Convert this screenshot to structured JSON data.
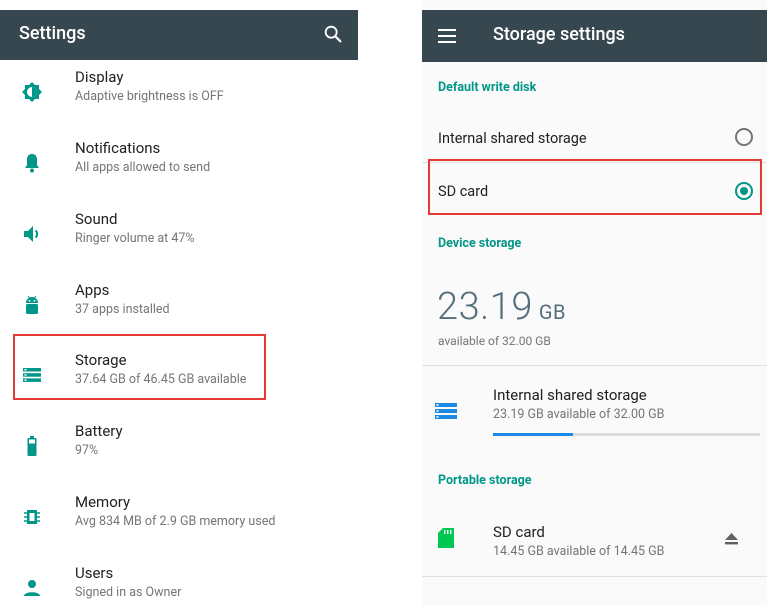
{
  "left": {
    "title": "Settings",
    "items": [
      {
        "title": "Display",
        "subtitle": "Adaptive brightness is OFF",
        "icon": "brightness-icon"
      },
      {
        "title": "Notifications",
        "subtitle": "All apps allowed to send",
        "icon": "bell-icon"
      },
      {
        "title": "Sound",
        "subtitle": "Ringer volume at 47%",
        "icon": "volume-icon"
      },
      {
        "title": "Apps",
        "subtitle": "37 apps installed",
        "icon": "android-icon"
      },
      {
        "title": "Storage",
        "subtitle": "37.64 GB of 46.45 GB available",
        "icon": "storage-icon"
      },
      {
        "title": "Battery",
        "subtitle": "97%",
        "icon": "battery-icon"
      },
      {
        "title": "Memory",
        "subtitle": "Avg 834 MB of 2.9 GB memory used",
        "icon": "memory-icon"
      },
      {
        "title": "Users",
        "subtitle": "Signed in as Owner",
        "icon": "person-icon"
      }
    ]
  },
  "right": {
    "title": "Storage settings",
    "default_write_disk": "Default write disk",
    "options": [
      {
        "label": "Internal shared storage",
        "selected": false
      },
      {
        "label": "SD card",
        "selected": true
      }
    ],
    "device_storage": "Device storage",
    "big_value": "23.19",
    "big_unit": "GB",
    "available_of": "available of 32.00 GB",
    "internal": {
      "title": "Internal shared storage",
      "subtitle": "23.19 GB available of 32.00 GB",
      "used_fraction": 0.3
    },
    "portable_storage": "Portable storage",
    "sdcard": {
      "title": "SD card",
      "subtitle": "14.45 GB available of 14.45 GB"
    }
  },
  "colors": {
    "appbar": "#37474f",
    "accent": "#009688",
    "progress": "#1e88e5",
    "highlight": "#e53935"
  }
}
